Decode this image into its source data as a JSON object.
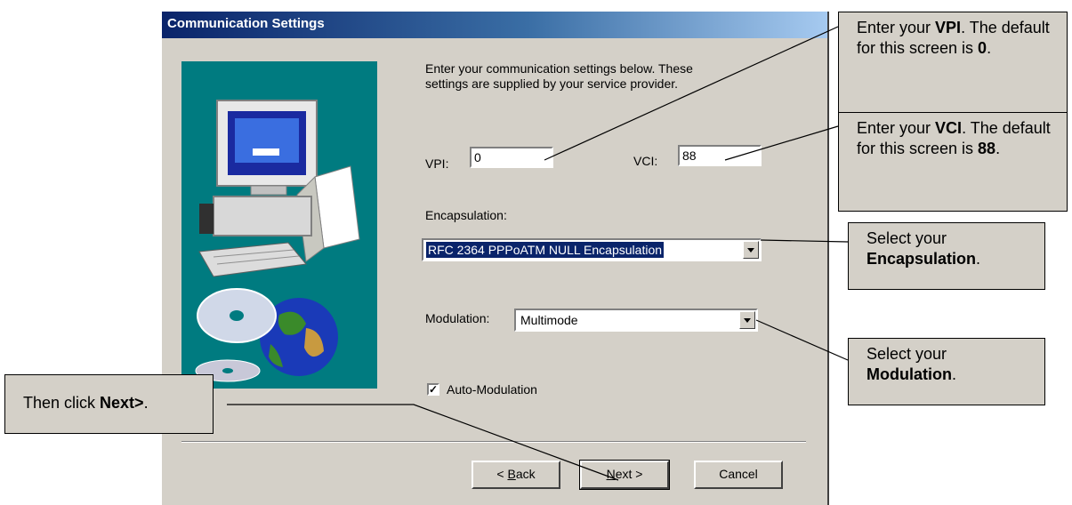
{
  "dialog": {
    "title": "Communication Settings",
    "intro_line1": "Enter your communication settings below.  These",
    "intro_line2": "settings are supplied by your service provider.",
    "vpi_label": "VPI:",
    "vpi_value": "0",
    "vci_label": "VCI:",
    "vci_value": "88",
    "encapsulation_label": "Encapsulation:",
    "encapsulation_value": "RFC 2364 PPPoATM NULL Encapsulation",
    "modulation_label": "Modulation:",
    "modulation_value": "Multimode",
    "auto_modulation_label": "Auto-Modulation",
    "auto_modulation_checked": true,
    "back_mnemonic": "B",
    "back_rest": "ack",
    "back_prefix": "< ",
    "next_mnemonic": "N",
    "next_rest": "ext >",
    "cancel_label": "Cancel"
  },
  "callouts": {
    "vpi": {
      "pre": "Enter your ",
      "bold": "VPI",
      "post": ".  The default for this screen is ",
      "bold2": "0",
      "end": "."
    },
    "vci": {
      "pre": "Enter your ",
      "bold": "VCI",
      "post": ". The default for this screen is ",
      "bold2": "88",
      "end": "."
    },
    "encapsulation": {
      "pre": "Select your ",
      "bold": "Encapsulation",
      "end": "."
    },
    "modulation": {
      "pre": "Select your ",
      "bold": "Modulation",
      "end": "."
    },
    "next": {
      "pre": "Then click ",
      "bold": "Next>",
      "end": "."
    }
  },
  "colors": {
    "panel": "#d4d0c8",
    "title_start": "#0a246a",
    "title_end": "#a6caf0",
    "side_panel": "#007b80",
    "selection": "#0a246a"
  }
}
